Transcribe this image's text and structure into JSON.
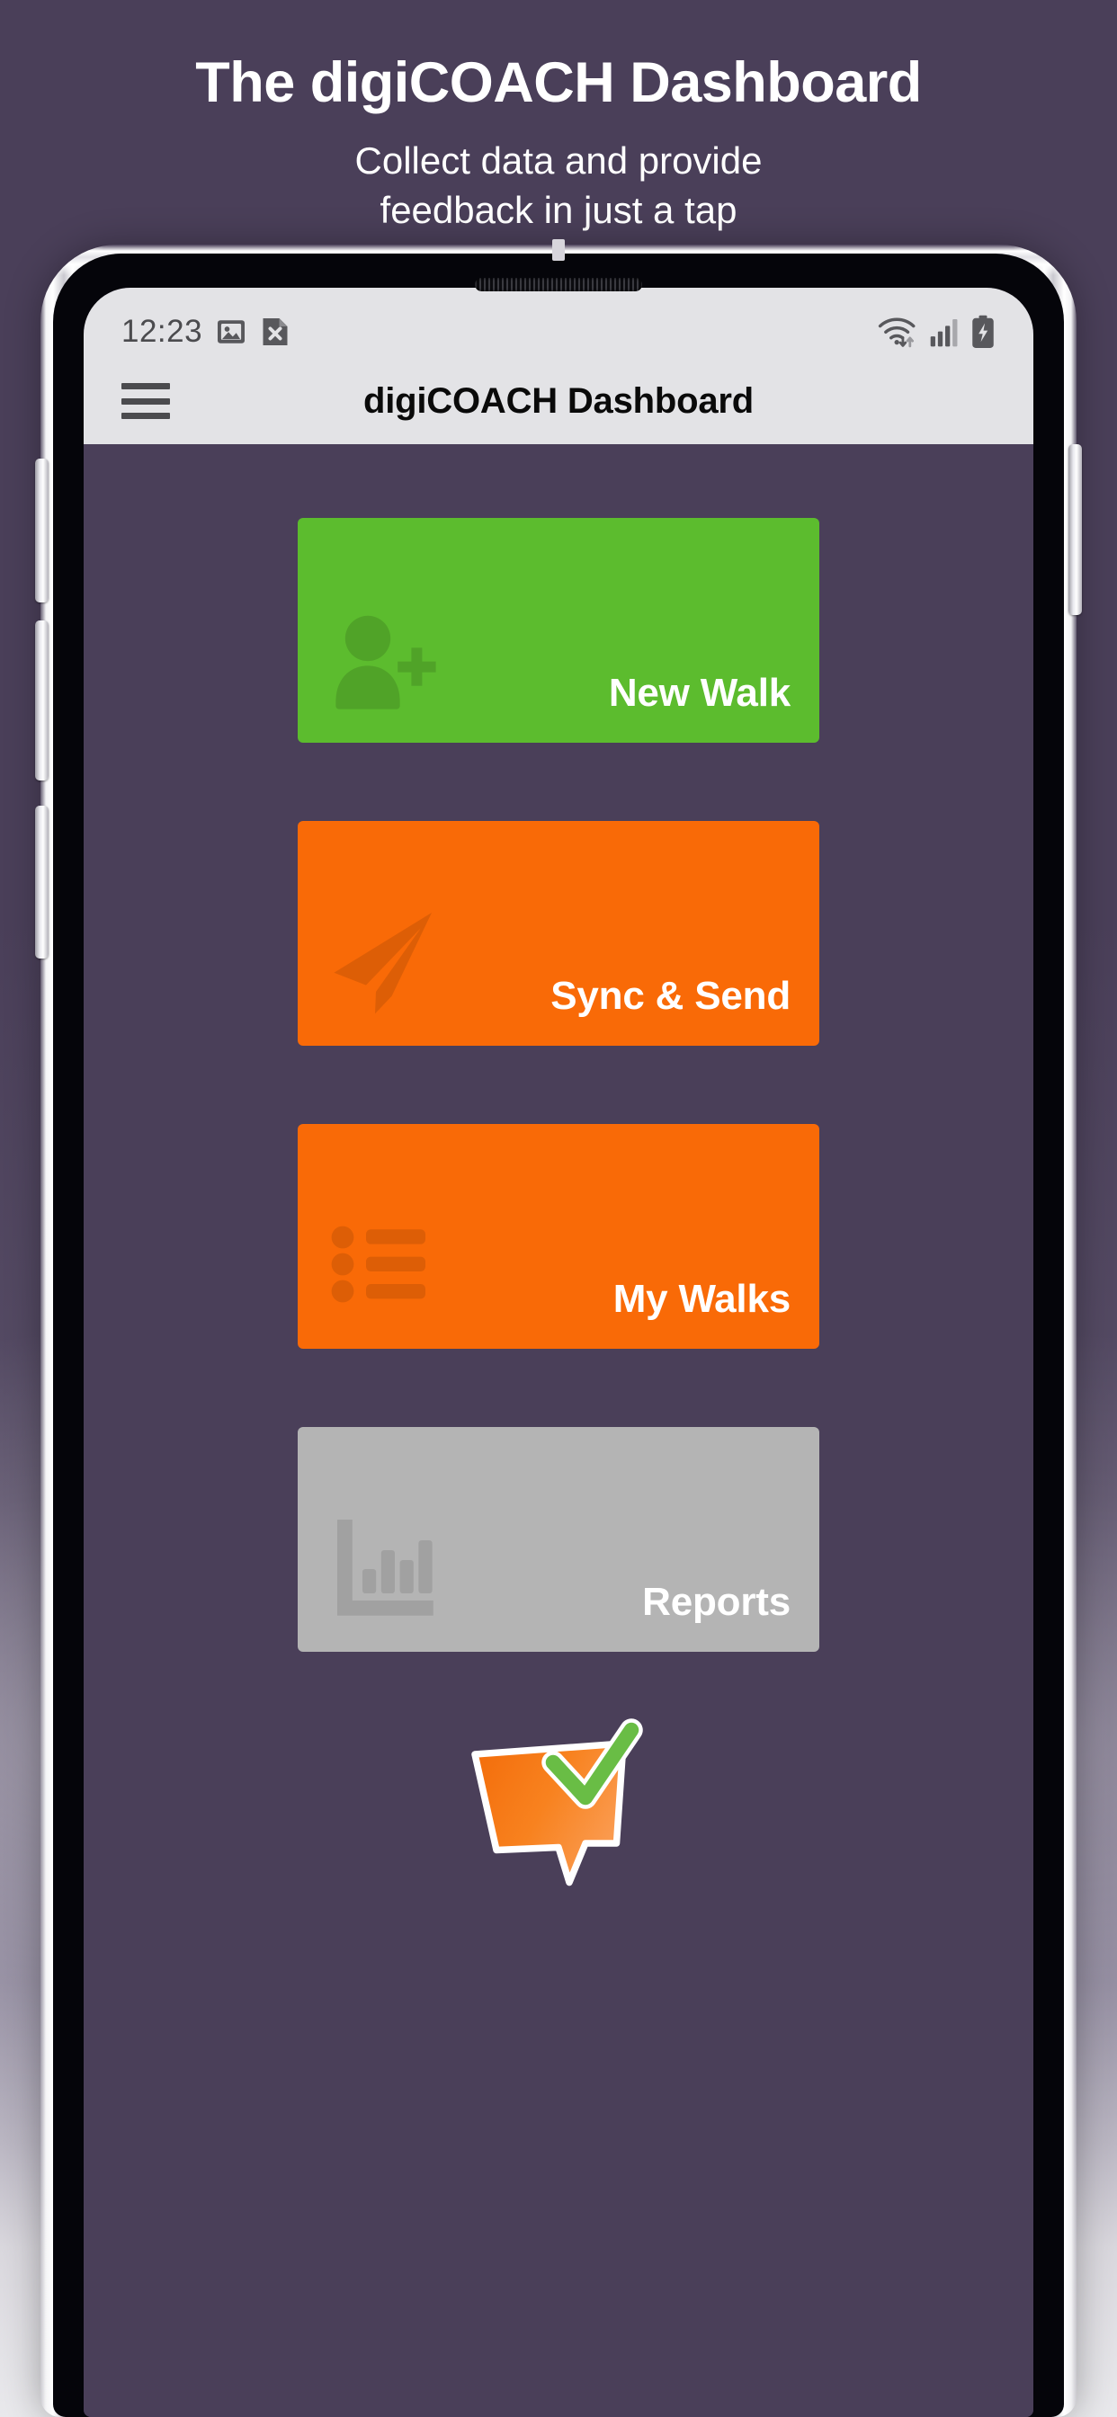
{
  "promo": {
    "title": "The digiCOACH Dashboard",
    "subtitle_line1": "Collect data and provide",
    "subtitle_line2": "feedback in just a tap"
  },
  "phone": {
    "status_bar": {
      "time": "12:23",
      "left_icons": [
        "image-icon",
        "file-x-icon"
      ],
      "right_icons": [
        "wifi-icon",
        "cell-signal-icon",
        "battery-charging-icon"
      ]
    },
    "app_bar": {
      "menu_icon": "hamburger-menu-icon",
      "title": "digiCOACH Dashboard"
    },
    "tiles": [
      {
        "label": "New Walk",
        "icon": "person-add-icon",
        "color": "#5cbc2e",
        "enabled": true
      },
      {
        "label": "Sync & Send",
        "icon": "paper-plane-icon",
        "color": "#f96a07",
        "enabled": true
      },
      {
        "label": "My Walks",
        "icon": "bullet-list-icon",
        "color": "#f96a07",
        "enabled": true
      },
      {
        "label": "Reports",
        "icon": "bar-chart-icon",
        "color": "#b4b4b4",
        "enabled": false
      }
    ],
    "logo": {
      "name": "digicoach-logo",
      "description": "orange speech bubble with green check mark",
      "bubble_color": "#f97a10",
      "check_color": "#69bd45"
    }
  },
  "colors": {
    "backdrop_purple": "#4a3f59",
    "accent_green": "#5cbc2e",
    "accent_orange": "#f96a07",
    "disabled_grey": "#b4b4b4",
    "statusbar_grey": "#e3e3e6"
  }
}
